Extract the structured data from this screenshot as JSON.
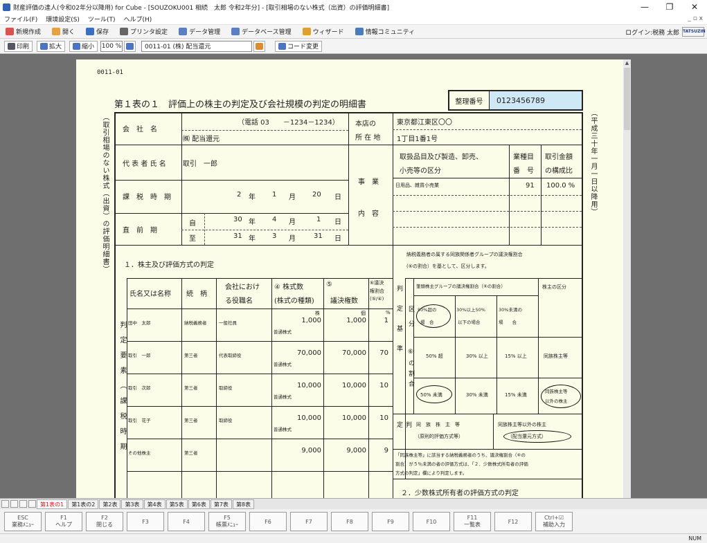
{
  "window": {
    "title": "財産評価の達人(令和02年分以降用) for Cube - [SOUZOKU001 相続　太郎 令和2年分] - [取引相場のない株式（出資）の評価明細書]",
    "controls": [
      "—",
      "❐",
      "✕"
    ]
  },
  "menu": {
    "items": [
      "ファイル(F)",
      "環境設定(S)",
      "ツール(T)",
      "ヘルプ(H)"
    ],
    "mdi_controls": "_ ▫ x"
  },
  "toolbar": {
    "items": [
      {
        "label": "新規作成",
        "color": "#d9534f"
      },
      {
        "label": "開く",
        "color": "#e6a23c"
      },
      {
        "label": "保存",
        "color": "#3b6fc4"
      },
      {
        "label": "プリンタ設定",
        "color": "#666666"
      },
      {
        "label": "データ管理",
        "color": "#5b7fc2"
      },
      {
        "label": "データベース管理",
        "color": "#5b7fc2"
      },
      {
        "label": "ウィザード",
        "color": "#e0a030"
      },
      {
        "label": "情報コミュニティ",
        "color": "#4a7dbf"
      }
    ],
    "login": "ログイン:税務 太郎",
    "brand": "TATSUZIN"
  },
  "toolbar2": {
    "print": "印刷",
    "zoom_in": "拡大",
    "zoom_out": "縮小",
    "zoom_value": "100 %",
    "form_select": "0011-01 (株) 配当還元",
    "code_change": "コード変更"
  },
  "form": {
    "sheet_no": "0011-01",
    "title": "第１表の１　評価上の株主の判定及び会社規模の判定の明細書",
    "seiri_label": "整理番号",
    "seiri_value": "0123456789",
    "left_vertical": "（取引相場のない株式（出資）の評価明細書）",
    "right_vertical": "（平成三十年一月一日以降用）",
    "company_label": "会　社　名",
    "phone": "（電話 03　　－1234－1234）",
    "company_name": "㈱ 配当還元",
    "honten_label1": "本店の",
    "honten_label2": "所 在 地",
    "address1": "東京都江東区〇〇",
    "address2": "1丁目1番1号",
    "rep_label": "代 表 者 氏 名",
    "rep_name": "取引　一郎",
    "jigyo1": "事　業",
    "jigyo2": "内　容",
    "biz_head1": "取扱品目及び製造、卸売、",
    "biz_head2": "小売等の区分",
    "biz_code_head1": "業種目",
    "biz_code_head2": "番　号",
    "biz_ratio_head1": "取引金額",
    "biz_ratio_head2": "の構成比",
    "biz_item": "日用品、雑貨小売業",
    "biz_code": "91",
    "biz_ratio": "100.0 %",
    "kazei_label": "課　税　時　期",
    "kazei_y": "2",
    "kazei_m": "1",
    "kazei_d": "20",
    "nen": "年",
    "tsuki": "月",
    "hi": "日",
    "chokuzen_label": "直　前　期",
    "ji": "自",
    "itaru": "至",
    "from_y": "30",
    "from_m": "4",
    "from_d": "1",
    "to_y": "31",
    "to_m": "3",
    "to_d": "31",
    "section1": "１．株主及び評価方式の判定",
    "col_name": "氏名又は名称",
    "col_rel": "続　柄",
    "col_pos1": "会社におけ",
    "col_pos2": "る役職名",
    "col_shares1": "④ 株式数",
    "col_shares2": "(株式の種類)",
    "col_votes1": "⑤",
    "col_votes2": "議決権数",
    "col_ratio1": "⑥議決",
    "col_ratio2": "権割合",
    "col_ratio3": "(⑤/④)",
    "unit_kabu": "株",
    "unit_ko": "個",
    "unit_pct": "%",
    "left_side": "判定要素（課税時期",
    "shareholders": [
      {
        "name": "田中　太郎",
        "rel": "納税義務者",
        "pos": "一般社員",
        "shares": "1,000",
        "kind": "普通株式",
        "votes": "1,000",
        "ratio": "1"
      },
      {
        "name": "取引　一郎",
        "rel": "第三者",
        "pos": "代表取締役",
        "shares": "70,000",
        "kind": "普通株式",
        "votes": "70,000",
        "ratio": "70"
      },
      {
        "name": "取引　次郎",
        "rel": "第三者",
        "pos": "取締役",
        "shares": "10,000",
        "kind": "普通株式",
        "votes": "10,000",
        "ratio": "10"
      },
      {
        "name": "取引　花子",
        "rel": "第三者",
        "pos": "取締役",
        "shares": "10,000",
        "kind": "普通株式",
        "votes": "10,000",
        "ratio": "10"
      },
      {
        "name": "その他株主",
        "rel": "第三者",
        "pos": "",
        "shares": "9,000",
        "kind": "",
        "votes": "9,000",
        "ratio": "9"
      }
    ],
    "judge_text1": "納税義務者の属する同族関係者グループの議決権割合",
    "judge_text2": "(⑥の割合）を基として、区分します。",
    "judge_side": "判定基準",
    "kubun": "区分",
    "ratio_side": "⑥の割合",
    "group_head": "筆頭株主グループの議決権割合（⑥の割合）",
    "class_head": "株主の区分",
    "h_over50_1": "50%超の",
    "h_over50_2": "場　合",
    "h_30to50_1": "30%以上50%",
    "h_30to50_2": "以下の場合",
    "h_under30_1": "30%未満の",
    "h_under30_2": "場　　合",
    "r1c1": "50% 超",
    "r1c2": "30% 以上",
    "r1c3": "15% 以上",
    "r1c4": "同族株主等",
    "r2c1": "50% 未満",
    "r2c2": "30% 未満",
    "r2c3": "15% 未満",
    "r2c4a": "同族株主等",
    "r2c4b": "以外の株主",
    "hantei": "判定",
    "dozoku1": "同　族　株　主　等",
    "dozoku2": "（原則的評価方式等）",
    "dozoku_igai1": "同族株主等以外の株主",
    "dozoku_igai2": "（配当還元方式）",
    "note1": "「同族株主等」に該当する納税義務者のうち、議決権割合（⑥の",
    "note2": "割合）が５％未満の者の評価方式は、「２．少数株式所有者の評価",
    "note3": "方式の判定」欄により判定します。",
    "section2": "２．少数株式所有者の評価方式の判定"
  },
  "sheet_tabs": [
    "第1表の1",
    "第1表の2",
    "第2表",
    "第3表",
    "第4表",
    "第5表",
    "第6表",
    "第7表",
    "第8表"
  ],
  "fkeys": [
    {
      "key": "ESC",
      "label": "業務ﾒﾆｭｰ"
    },
    {
      "key": "F1",
      "label": "ヘルプ"
    },
    {
      "key": "F2",
      "label": "閉じる"
    },
    {
      "key": "F3",
      "label": ""
    },
    {
      "key": "F4",
      "label": ""
    },
    {
      "key": "F5",
      "label": "帳票ﾒﾆｭｰ"
    },
    {
      "key": "F6",
      "label": ""
    },
    {
      "key": "F7",
      "label": ""
    },
    {
      "key": "F8",
      "label": ""
    },
    {
      "key": "F9",
      "label": ""
    },
    {
      "key": "F10",
      "label": ""
    },
    {
      "key": "F11",
      "label": "一覧表"
    },
    {
      "key": "F12",
      "label": ""
    },
    {
      "key": "Ctrl+☑",
      "label": "補助入力"
    }
  ],
  "status": "NUM"
}
